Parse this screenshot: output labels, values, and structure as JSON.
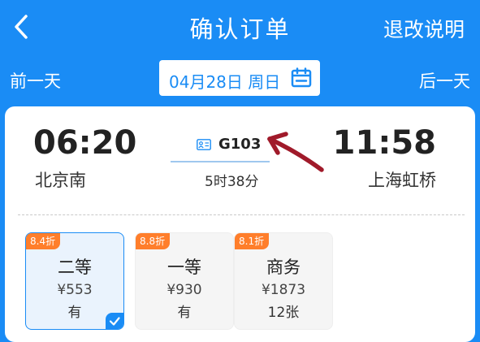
{
  "header": {
    "title": "确认订单",
    "rules_link": "退改说明"
  },
  "datebar": {
    "prev_day": "前一天",
    "next_day": "后一天",
    "date": "04月28日 周日"
  },
  "trip": {
    "depart_time": "06:20",
    "depart_station": "北京南",
    "arrive_time": "11:58",
    "arrive_station": "上海虹桥",
    "train_no": "G103",
    "duration": "5时38分"
  },
  "seats": [
    {
      "discount": "8.4折",
      "class": "二等",
      "price": "¥553",
      "availability": "有",
      "selected": true
    },
    {
      "discount": "8.8折",
      "class": "一等",
      "price": "¥930",
      "availability": "有",
      "selected": false
    },
    {
      "discount": "8.1折",
      "class": "商务",
      "price": "¥1873",
      "availability": "12张",
      "selected": false
    }
  ],
  "colors": {
    "primary": "#1a8cf5",
    "discount_tag": "#ff7e2b",
    "annotation_arrow": "#a01a2a"
  },
  "icons": [
    "back-arrow-icon",
    "calendar-icon",
    "train-id-icon",
    "checkmark-icon"
  ]
}
